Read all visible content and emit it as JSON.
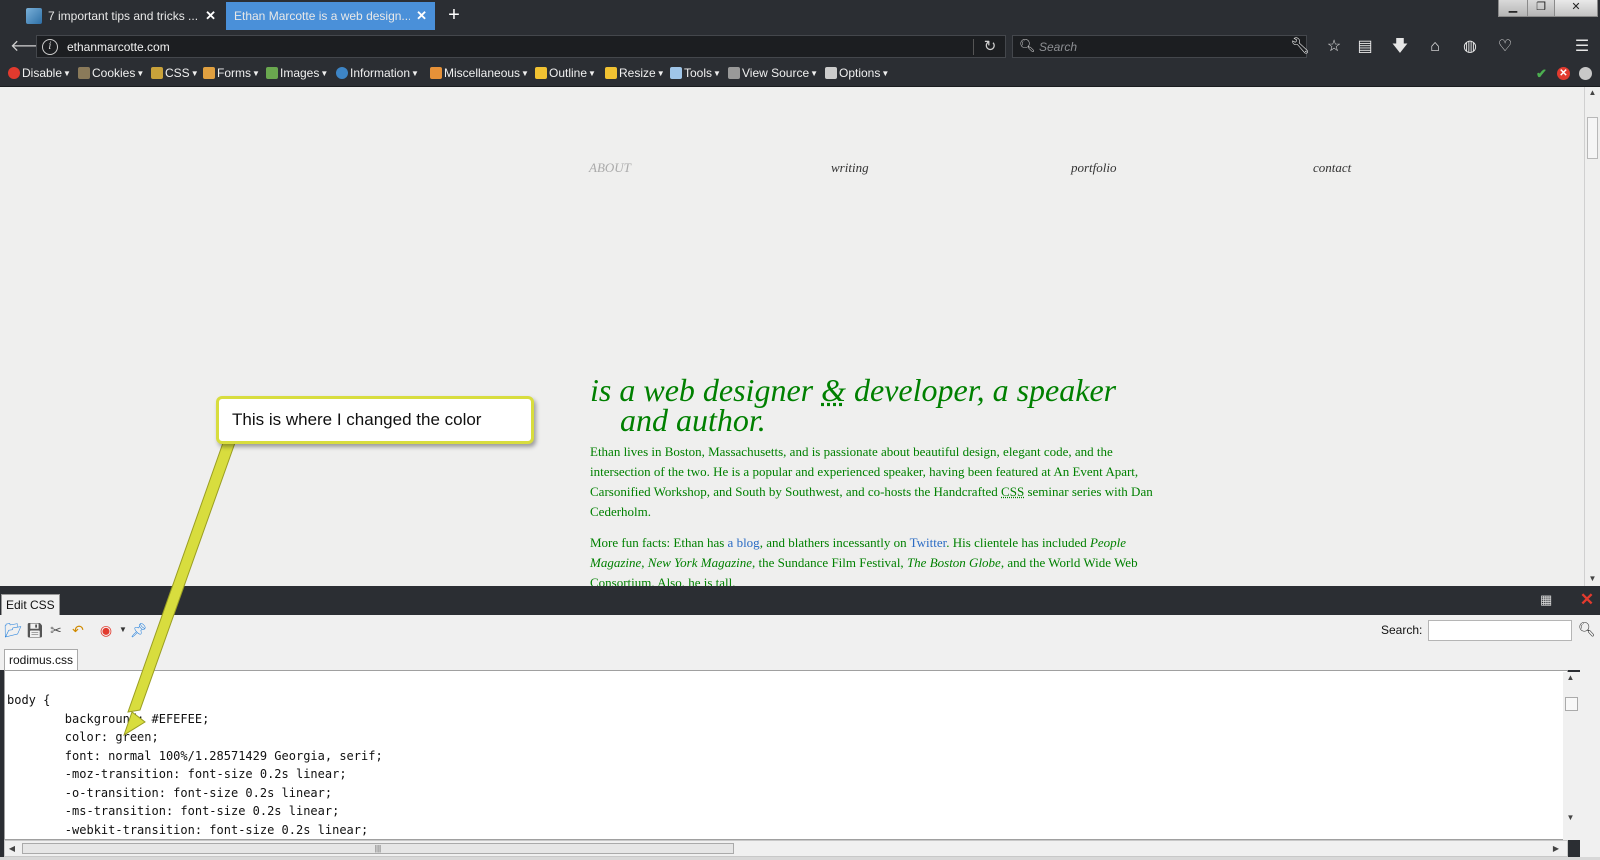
{
  "browser": {
    "tabs": [
      {
        "label": "7 important tips and tricks ..."
      },
      {
        "label": "Ethan Marcotte is a web design..."
      }
    ],
    "window_controls": {
      "minimize": "▁",
      "maximize": "❐",
      "close": "✕"
    },
    "url": "ethanmarcotte.com",
    "search_placeholder": "Search"
  },
  "webdev_toolbar": {
    "items": [
      "Disable",
      "Cookies",
      "CSS",
      "Forms",
      "Images",
      "Information",
      "Miscellaneous",
      "Outline",
      "Resize",
      "Tools",
      "View Source",
      "Options"
    ]
  },
  "page": {
    "nav": [
      "ABOUT",
      "writing",
      "portfolio",
      "contact"
    ],
    "headline_part1": "is a web designer ",
    "headline_amp": "&",
    "headline_part2": " developer, a speaker",
    "headline_line2": "and author.",
    "para1_a": "Ethan lives in Boston, Massachusetts, and is passionate about beautiful design, elegant code, and the intersection of the two. He is a popular and experienced speaker, having been featured at An Event Apart, Carsonified Workshop, and South by Southwest, and co-hosts the Handcrafted ",
    "para1_abbr": "CSS",
    "para1_b": " seminar series with Dan Cederholm.",
    "para2_a": "More fun facts: Ethan has ",
    "para2_link1": "a blog",
    "para2_b": ", and blathers incessantly on ",
    "para2_link2": "Twitter",
    "para2_c": ". His clientele has included ",
    "para2_i1": "People Magazine",
    "para2_d": ", ",
    "para2_i2": "New York Magazine",
    "para2_e": ", the Sundance Film Festival, ",
    "para2_i3": "The Boston Globe",
    "para2_f": ", and the World Wide Web Consortium. Also, he is tall."
  },
  "css_panel": {
    "title": "Edit CSS",
    "search_label": "Search:",
    "file_tab": "rodimus.css",
    "code": "body {\n        background: #EFEFEE;\n        color: green;\n        font: normal 100%/1.28571429 Georgia, serif;\n        -moz-transition: font-size 0.2s linear;\n        -o-transition: font-size 0.2s linear;\n        -ms-transition: font-size 0.2s linear;\n        -webkit-transition: font-size 0.2s linear;"
  },
  "annotation": {
    "text": "This is where I changed the color"
  },
  "colors": {
    "chrome_dark": "#2b2e33",
    "active_tab": "#4a90d9",
    "page_bg": "#EFEFEE",
    "page_text": "green",
    "callout_border": "#d8dd3e"
  }
}
